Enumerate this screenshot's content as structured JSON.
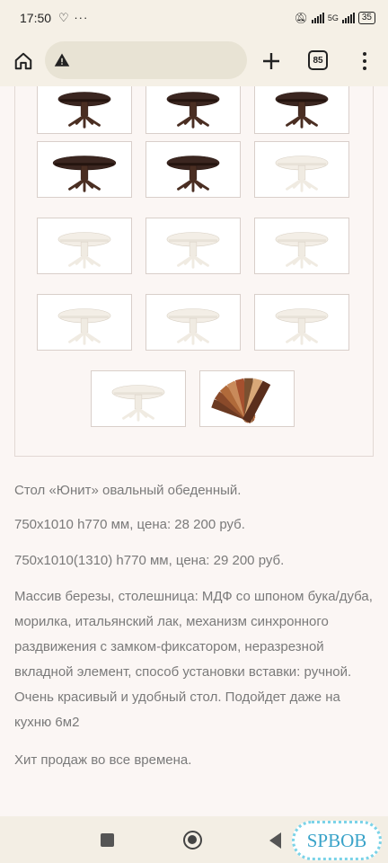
{
  "status_bar": {
    "time": "17:50",
    "left_icons": "♡ ···",
    "network": "5G",
    "battery": "35"
  },
  "toolbar": {
    "url_placeholder": "",
    "tab_count": "85"
  },
  "gallery": {
    "rows": [
      [
        "dark-table",
        "dark-table",
        "dark-table"
      ],
      [
        "dark-table-extended",
        "dark-table-oval",
        "white-table"
      ],
      [
        "white-table",
        "white-table",
        "white-table"
      ],
      [
        "white-table",
        "white-table",
        "white-table"
      ],
      [
        "white-table",
        "veneer-samples"
      ]
    ]
  },
  "description": {
    "p1": "Стол «Юнит» овальный обеденный.",
    "p2": "750х1010 h770 мм,  цена: 28 200 руб.",
    "p3": "750х1010(1310) h770 мм, цена: 29 200 руб.",
    "p4": "Массив березы, столешница: МДФ со шпоном бука/дуба, морилка, итальянский лак, механизм синхронного раздвижения с замком-фиксатором, неразрезной вкладной элемент, способ установки вставки: ручной. Очень красивый и удобный стол. Подойдет даже на кухню 6м2",
    "p5": "Хит продаж во все времена."
  },
  "watermark": {
    "text": "SPBOB"
  },
  "colors": {
    "chrome": "#f5f0e6",
    "page": "#fbf6f4",
    "text": "#7a7a7a",
    "dark_wood": "#3b2620",
    "white_table": "#f3eee6"
  }
}
